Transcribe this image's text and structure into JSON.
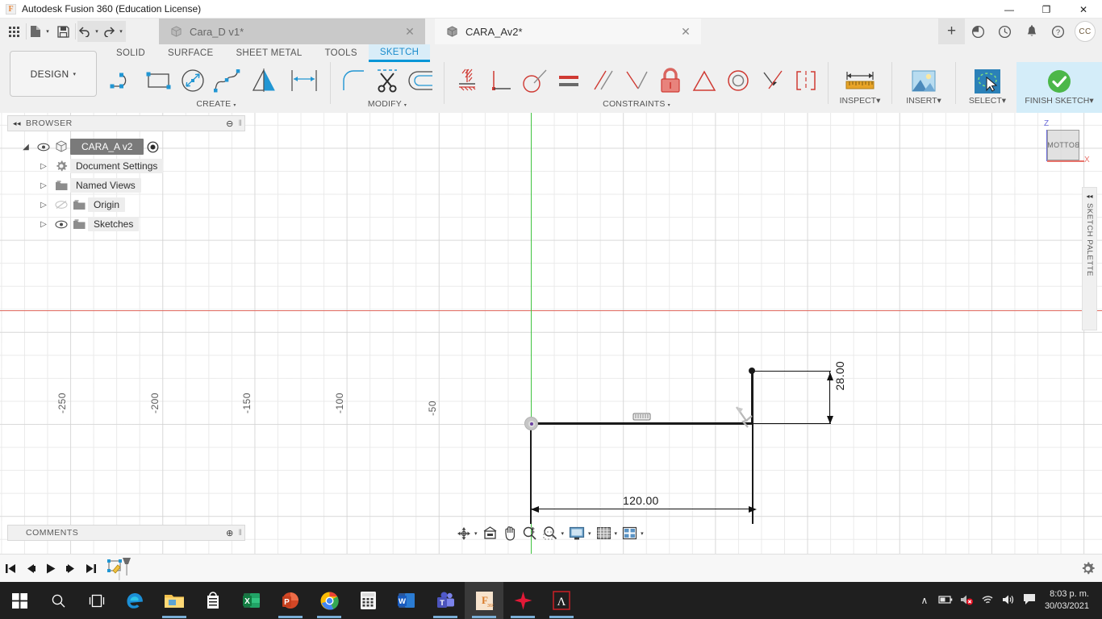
{
  "window": {
    "title": "Autodesk Fusion 360 (Education License)",
    "logo_text": "F",
    "minimize": "—",
    "maximize": "❐",
    "close": "✕"
  },
  "quick_access": {
    "grid_icon": "grid-icon",
    "new_icon": "new-document-icon",
    "save_icon": "save-icon",
    "undo_icon": "undo-icon",
    "redo_icon": "redo-icon",
    "caret": "▾"
  },
  "document_tabs": [
    {
      "label": "Cara_D v1*",
      "active": false,
      "close": "✕"
    },
    {
      "label": "CARA_Av2*",
      "active": true,
      "close": "✕"
    }
  ],
  "titlebar_right": {
    "add_label": "+",
    "job_status_icon": "job-status-icon",
    "recent_icon": "recent-icon",
    "notifications_icon": "bell-icon",
    "help_icon": "help-icon",
    "account_initials": "CC"
  },
  "ribbon": {
    "design_button": "DESIGN",
    "caret": "▾",
    "tabs": [
      {
        "label": "SOLID",
        "active": false
      },
      {
        "label": "SURFACE",
        "active": false
      },
      {
        "label": "SHEET METAL",
        "active": false
      },
      {
        "label": "TOOLS",
        "active": false
      },
      {
        "label": "SKETCH",
        "active": true
      }
    ],
    "panels": [
      {
        "label": "CREATE",
        "has_caret": true,
        "tools": [
          "line-icon",
          "rectangle-icon",
          "circle-diameter-icon",
          "spline-icon",
          "mirror-icon",
          "sketch-dimension-icon"
        ]
      },
      {
        "label": "MODIFY",
        "has_caret": true,
        "tools": [
          "fillet-icon",
          "trim-scissors-icon",
          "offset-icon"
        ]
      },
      {
        "label": "CONSTRAINTS",
        "has_caret": true,
        "tools": [
          "horizontal-vertical-constraint-icon",
          "perpendicular-icon",
          "tangent-icon",
          "equal-icon",
          "parallel-icon",
          "collinear-icon",
          "fix-lock-icon",
          "symmetry-icon",
          "concentric-icon",
          "midpoint-icon",
          "curvature-icon"
        ]
      }
    ],
    "right_buttons": [
      {
        "label": "INSPECT",
        "icon": "measure-ruler-icon",
        "caret": "▾",
        "highlighted": false
      },
      {
        "label": "INSERT",
        "icon": "insert-image-icon",
        "caret": "▾",
        "highlighted": false
      },
      {
        "label": "SELECT",
        "icon": "select-cursor-icon",
        "caret": "▾",
        "highlighted": false
      },
      {
        "label": "FINISH SKETCH",
        "icon": "green-check-icon",
        "caret": "▾",
        "highlighted": true
      }
    ]
  },
  "browser": {
    "header": "BROWSER",
    "collapse_icon": "◂◂",
    "minus_icon": "⊖",
    "grip_icon": "‖",
    "nodes": [
      {
        "label": "CARA_A v2",
        "caret": "◢",
        "eye": "eye-visible-icon",
        "icon": "component-cube-icon",
        "root": true,
        "activate": "activate-radio-icon"
      },
      {
        "label": "Document Settings",
        "caret": "▷",
        "icon": "gear-icon",
        "root": false
      },
      {
        "label": "Named Views",
        "caret": "▷",
        "icon": "folder-icon",
        "root": false
      },
      {
        "label": "Origin",
        "caret": "▷",
        "eye": "eye-hidden-icon",
        "icon": "folder-icon",
        "root": false
      },
      {
        "label": "Sketches",
        "caret": "▷",
        "eye": "eye-visible-icon",
        "icon": "folder-icon",
        "root": false
      }
    ]
  },
  "comments": {
    "header": "COMMENTS",
    "add_icon": "⊕",
    "grip_icon": "‖"
  },
  "canvas": {
    "x_axis_ticks": [
      "-250",
      "-200",
      "-150",
      "-100",
      "-50"
    ],
    "sketch_dimensions": [
      {
        "name": "horizontal-dimension",
        "value": "120.00"
      },
      {
        "name": "vertical-dimension",
        "value": "28.00"
      }
    ],
    "origin_point": "sketch-origin-point",
    "constraint_badge": "horizontal-constraint-badge",
    "cursor": "dimension-cursor"
  },
  "view_cube": {
    "face_label": "BOTTOM",
    "axis_z": "Z",
    "axis_x": "X"
  },
  "sketch_palette": {
    "label": "SKETCH PALETTE",
    "collapse_icon": "◂◂"
  },
  "nav_bar": {
    "buttons": [
      {
        "icon": "orbit-icon",
        "caret": "▾"
      },
      {
        "icon": "pan-home-icon",
        "caret": ""
      },
      {
        "icon": "pan-hand-icon",
        "caret": ""
      },
      {
        "icon": "zoom-icon",
        "caret": ""
      },
      {
        "icon": "zoom-window-icon",
        "caret": "▾"
      },
      {
        "icon": "display-settings-icon",
        "caret": "▾"
      },
      {
        "icon": "grid-snaps-icon",
        "caret": "▾"
      },
      {
        "icon": "viewports-icon",
        "caret": "▾"
      }
    ]
  },
  "timeline": {
    "buttons": [
      "skip-to-start-icon",
      "step-back-icon",
      "play-icon",
      "step-forward-icon",
      "skip-to-end-icon",
      "sketch-feature-icon"
    ],
    "settings_icon": "gear-icon"
  },
  "taskbar": {
    "items": [
      {
        "name": "start-button",
        "icon": "windows-logo-icon",
        "active": false,
        "running": false
      },
      {
        "name": "search-button",
        "icon": "search-icon",
        "active": false,
        "running": false
      },
      {
        "name": "task-view-button",
        "icon": "task-view-icon",
        "active": false,
        "running": false
      },
      {
        "name": "taskbar-edge",
        "icon": "edge-icon",
        "active": false,
        "running": false
      },
      {
        "name": "taskbar-file-explorer",
        "icon": "file-explorer-icon",
        "active": false,
        "running": true
      },
      {
        "name": "taskbar-store",
        "icon": "store-icon",
        "active": false,
        "running": false
      },
      {
        "name": "taskbar-excel",
        "icon": "excel-icon",
        "active": false,
        "running": false
      },
      {
        "name": "taskbar-powerpoint",
        "icon": "powerpoint-icon",
        "active": false,
        "running": true
      },
      {
        "name": "taskbar-chrome",
        "icon": "chrome-icon",
        "active": false,
        "running": true
      },
      {
        "name": "taskbar-calculator",
        "icon": "calculator-icon",
        "active": false,
        "running": false
      },
      {
        "name": "taskbar-word",
        "icon": "word-icon",
        "active": false,
        "running": false
      },
      {
        "name": "taskbar-teams",
        "icon": "teams-icon",
        "active": false,
        "running": true
      },
      {
        "name": "taskbar-fusion360",
        "icon": "fusion360-icon",
        "active": true,
        "running": true
      },
      {
        "name": "taskbar-autodesk",
        "icon": "autodesk-icon",
        "active": false,
        "running": true
      },
      {
        "name": "taskbar-acrobat",
        "icon": "acrobat-icon",
        "active": false,
        "running": true
      }
    ],
    "tray": {
      "show_hidden": "∧",
      "battery_icon": "battery-icon",
      "sound_muted_icon": "sound-muted-icon",
      "wifi_icon": "wifi-icon",
      "volume_icon": "volume-icon",
      "action_center_icon": "action-center-icon",
      "time": "8:03 p. m.",
      "date": "30/03/2021"
    }
  },
  "colors": {
    "accent_blue": "#0696d7",
    "sketch_tab_bg": "#d9edf8",
    "finish_sketch_bg": "#d4edf9",
    "x_axis_red": "#e06a60",
    "y_axis_green": "#3fc33f",
    "constraint_red": "#d9534f",
    "origin_purple": "#6a3fa0",
    "taskbar_bg": "#1f1f1f"
  }
}
